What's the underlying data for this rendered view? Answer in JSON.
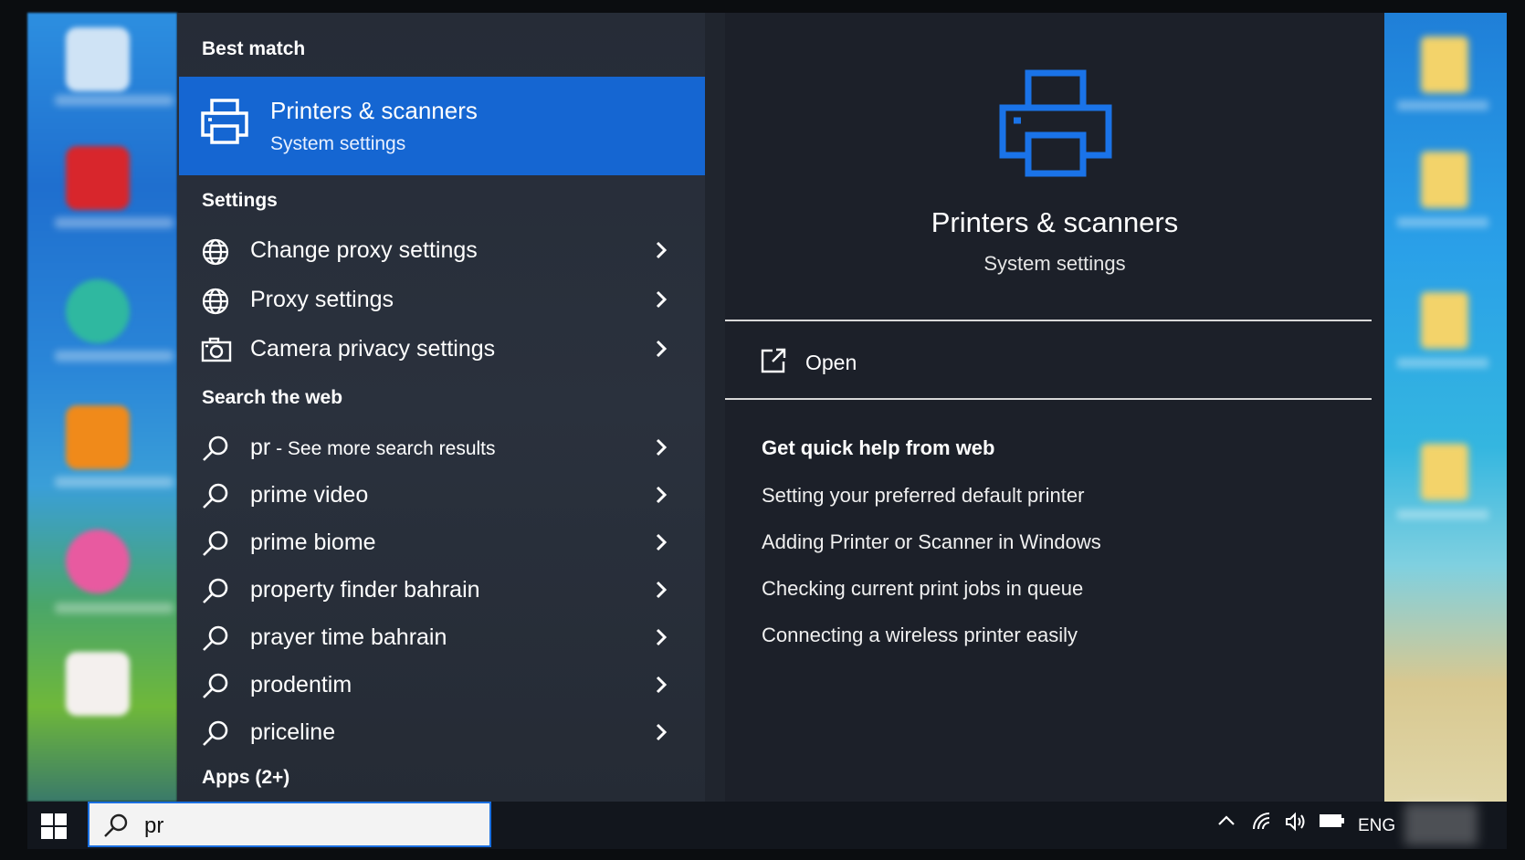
{
  "best_match": {
    "header": "Best match",
    "title": "Printers & scanners",
    "subtitle": "System settings"
  },
  "settings": {
    "header": "Settings",
    "items": [
      {
        "label": "Change proxy settings",
        "icon": "globe-icon"
      },
      {
        "label": "Proxy settings",
        "icon": "globe-icon"
      },
      {
        "label": "Camera privacy settings",
        "icon": "camera-icon"
      }
    ]
  },
  "web": {
    "header": "Search the web",
    "first": {
      "query": "pr",
      "suffix": " - See more search results"
    },
    "items": [
      {
        "label": "prime video"
      },
      {
        "label": "prime biome"
      },
      {
        "label": "property finder bahrain"
      },
      {
        "label": "prayer time bahrain"
      },
      {
        "label": "prodentim"
      },
      {
        "label": "priceline"
      }
    ]
  },
  "apps_header": "Apps (2+)",
  "preview": {
    "title": "Printers & scanners",
    "subtitle": "System settings",
    "open_label": "Open",
    "help_title": "Get quick help from web",
    "help_links": [
      "Setting your preferred default printer",
      "Adding Printer or Scanner in Windows",
      "Checking current print jobs in queue",
      "Connecting a wireless printer easily"
    ]
  },
  "taskbar": {
    "search_value": "pr",
    "language": "ENG"
  },
  "colors": {
    "accent": "#1566d2",
    "printer_icon": "#1a73e8"
  }
}
